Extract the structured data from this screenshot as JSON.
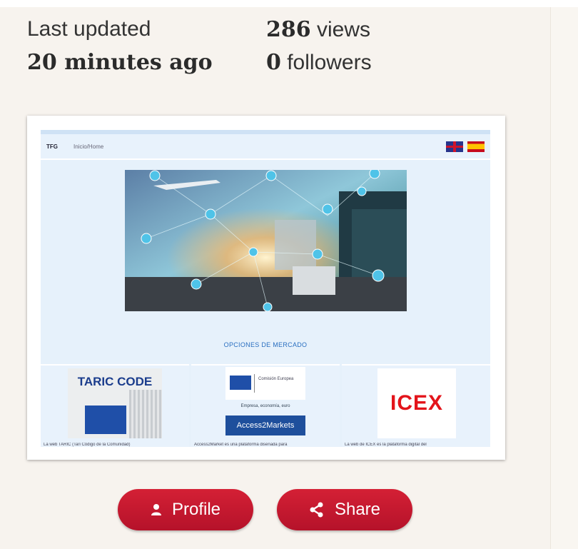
{
  "stats": {
    "last_updated_label": "Last updated",
    "last_updated_value": "20 minutes ago",
    "views_count": "286",
    "views_label": "views",
    "followers_count": "0",
    "followers_label": "followers"
  },
  "preview": {
    "brand": "TFG",
    "nav_link": "Inicio/Home",
    "section_title": "OPCIONES DE MERCADO",
    "cards": [
      {
        "logo_text": "TARIC CODE",
        "caption": "La web TARIC (Tari Código de la Comunidad)"
      },
      {
        "logo_text": "Comisión Europea",
        "tagline": "Empresa, economía, euro",
        "button": "Access2Markets",
        "caption": "Access2Market es una plataforma diseñada para"
      },
      {
        "logo_text": "ICEX",
        "caption": "La web de ICEX es la plataforma digital del"
      }
    ]
  },
  "actions": {
    "profile_label": "Profile",
    "share_label": "Share"
  },
  "colors": {
    "button_red": "#c8192f",
    "page_bg": "#f7f3ee"
  }
}
